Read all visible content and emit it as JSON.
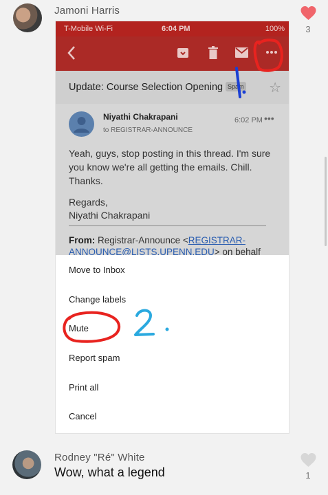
{
  "comment1": {
    "author": "Jamoni Harris",
    "like_count": "3",
    "like_color": "#f0656b"
  },
  "screenshot": {
    "status_bar": {
      "carrier": "T-Mobile Wi-Fi",
      "time": "6:04 PM",
      "battery": "100%"
    },
    "subject": "Update: Course Selection Opening",
    "subject_tag": "Spam",
    "sender_name": "Niyathi Chakrapani",
    "sender_to": "to REGISTRAR-ANNOUNCE",
    "sent_time": "6:02 PM",
    "body": "Yeah, guys, stop posting in this thread. I'm sure you know we're all getting the emails. Chill. Thanks.",
    "regards": "Regards,",
    "signature": "Niyathi Chakrapani",
    "from_label": "From:",
    "from_name": "Registrar-Announce <",
    "from_email": "REGISTRAR-ANNOUNCE@LISTS.UPENN.EDU",
    "from_tail": "> on behalf",
    "menu": [
      {
        "label": "Move to Inbox"
      },
      {
        "label": "Change labels"
      },
      {
        "label": "Mute"
      },
      {
        "label": "Report spam"
      },
      {
        "label": "Print all"
      },
      {
        "label": "Cancel"
      }
    ],
    "annotations": {
      "step1": "1.",
      "step2": "2.",
      "red": "#e8231f",
      "blue": "#1a3fd4",
      "cyan": "#2aa9df"
    }
  },
  "comment2": {
    "author": "Rodney \"Ré\" White",
    "text": "Wow, what a legend",
    "like_count": "1"
  }
}
